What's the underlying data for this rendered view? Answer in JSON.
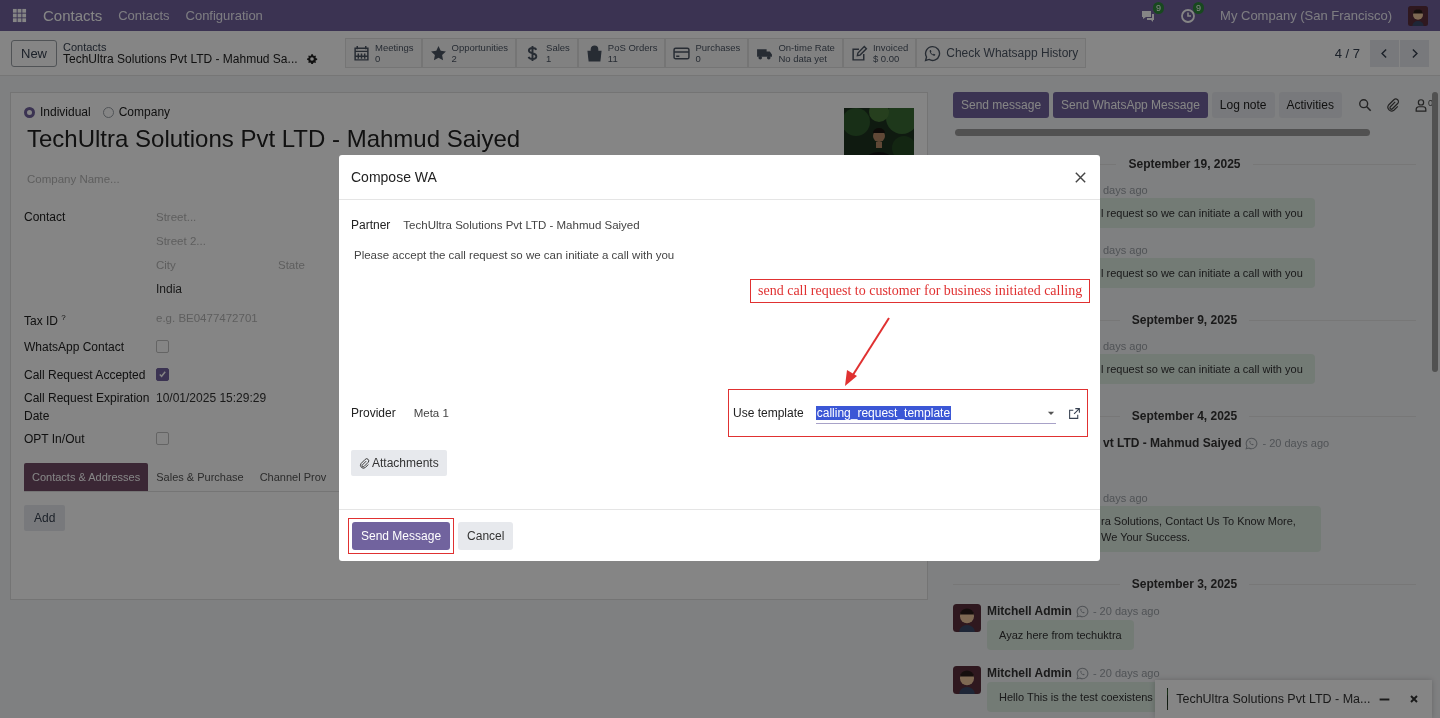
{
  "navbar": {
    "app": "Contacts",
    "menus": [
      "Contacts",
      "Configuration"
    ],
    "messages_badge": "9",
    "activities_badge": "9",
    "company": "My Company (San Francisco)"
  },
  "control_panel": {
    "new_button": "New",
    "breadcrumb_parent": "Contacts",
    "breadcrumb_current": "TechUltra Solutions Pvt LTD - Mahmud Sa...",
    "stat_buttons": [
      {
        "kind": "calendar",
        "label": "Meetings",
        "value": "0"
      },
      {
        "kind": "star",
        "label": "Opportunities",
        "value": "2"
      },
      {
        "kind": "dollar",
        "label": "Sales",
        "value": "1"
      },
      {
        "kind": "bag",
        "label": "PoS Orders",
        "value": "11"
      },
      {
        "kind": "card",
        "label": "Purchases",
        "value": "0"
      },
      {
        "kind": "truck",
        "label": "On-time Rate",
        "value": "No data yet"
      },
      {
        "kind": "edit",
        "label": "Invoiced",
        "value": "$ 0.00"
      },
      {
        "kind": "whatsapp",
        "label": "Check Whatsapp History"
      }
    ],
    "pager": "4 / 7"
  },
  "form": {
    "type_options": [
      {
        "label": "Individual",
        "selected": true
      },
      {
        "label": "Company",
        "selected": false
      }
    ],
    "name": "TechUltra Solutions Pvt LTD - Mahmud Saiyed",
    "company_placeholder": "Company Name...",
    "contact_label": "Contact",
    "address": {
      "street_placeholder": "Street...",
      "street2_placeholder": "Street 2...",
      "city_placeholder": "City",
      "state_placeholder": "State",
      "country": "India"
    },
    "tax_id": {
      "label": "Tax ID",
      "help": "?",
      "placeholder": "e.g. BE0477472701"
    },
    "fields": [
      {
        "kind": "checkbox",
        "label": "WhatsApp Contact",
        "checked": false
      },
      {
        "kind": "checkbox",
        "label": "Call Request Accepted",
        "checked": true
      },
      {
        "kind": "text",
        "label": "Call Request Expiration Date",
        "value": "10/01/2025 15:29:29"
      },
      {
        "kind": "checkbox",
        "label": "OPT In/Out",
        "checked": false
      }
    ],
    "tabs": [
      {
        "label": "Contacts & Addresses",
        "selected": true
      },
      {
        "label": "Sales & Purchase",
        "selected": false
      },
      {
        "label": "Channel Prov",
        "selected": false
      }
    ],
    "add_button": "Add"
  },
  "chatter": {
    "buttons": [
      {
        "label": "Send message",
        "kind": "primary"
      },
      {
        "label": "Send WhatsApp Message",
        "kind": "primary"
      },
      {
        "label": "Log note",
        "kind": "secondary"
      },
      {
        "label": "Activities",
        "kind": "secondary"
      }
    ],
    "followers": "0",
    "feed": [
      {
        "kind": "date",
        "label": "September 19, 2025"
      },
      {
        "kind": "message",
        "partial": true,
        "time": "days ago",
        "body": "l request so we can initiate a call with you"
      },
      {
        "kind": "message",
        "partial": true,
        "time": "days ago",
        "body": "l request so we can initiate a call with you"
      },
      {
        "kind": "date",
        "label": "September 9, 2025"
      },
      {
        "kind": "message",
        "partial": true,
        "time": "days ago",
        "body": "l request so we can initiate a call with you"
      },
      {
        "kind": "date",
        "label": "September 4, 2025"
      },
      {
        "kind": "message",
        "partial": true,
        "author": "vt LTD - Mahmud Saiyed",
        "time": "- 20 days ago"
      },
      {
        "kind": "message",
        "partial": true,
        "time": "days ago",
        "body": "ra Solutions, Contact Us To Know More, We Your Success."
      },
      {
        "kind": "date",
        "label": "September 3, 2025"
      },
      {
        "kind": "message",
        "partial": false,
        "author": "Mitchell Admin",
        "time": "- 20 days ago",
        "body": "Ayaz here from techuktra"
      },
      {
        "kind": "message",
        "partial": false,
        "author": "Mitchell Admin",
        "time": "- 20 days ago",
        "body": "Hello This is the test coexistens"
      }
    ]
  },
  "chat_window": {
    "title": "TechUltra Solutions Pvt LTD - Ma..."
  },
  "compose": {
    "title": "Compose WA",
    "partner_label": "Partner",
    "partner": "TechUltra Solutions Pvt LTD - Mahmud Saiyed",
    "message": "Please accept the call request so we can initiate a call with you",
    "provider_label": "Provider",
    "provider": "Meta 1",
    "template_label": "Use template",
    "template": "calling_request_template",
    "attachments_button": "Attachments",
    "send_button": "Send Message",
    "cancel_button": "Cancel"
  },
  "annotation": {
    "callout": "send call request to customer for business initiated calling"
  }
}
